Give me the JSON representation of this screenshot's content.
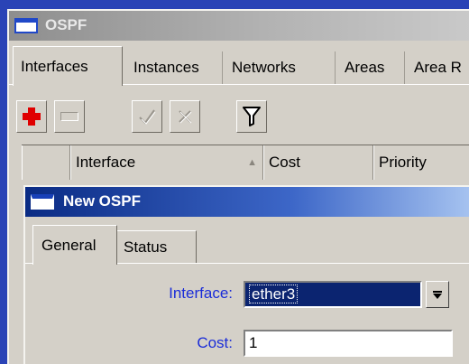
{
  "ospf_window": {
    "title": "OSPF",
    "tabs": [
      "Interfaces",
      "Instances",
      "Networks",
      "Areas",
      "Area R"
    ],
    "active_tab": "Interfaces",
    "toolbar": {
      "add_icon": "plus-icon",
      "remove_icon": "minus-icon",
      "enable_icon": "check-icon",
      "disable_icon": "x-icon",
      "filter_icon": "filter-icon"
    },
    "columns": [
      "Interface",
      "Cost",
      "Priority"
    ]
  },
  "new_ospf_dialog": {
    "title": "New OSPF",
    "tabs": [
      "General",
      "Status"
    ],
    "active_tab": "General",
    "fields": {
      "interface_label": "Interface:",
      "interface_value": "ether3",
      "cost_label": "Cost:",
      "cost_value": "1"
    }
  },
  "colors": {
    "desktop": "#2a43b6",
    "window_face": "#d4d0c8",
    "label_blue": "#1a2cd8",
    "selection": "#0b2470",
    "add_red": "#e00000"
  }
}
